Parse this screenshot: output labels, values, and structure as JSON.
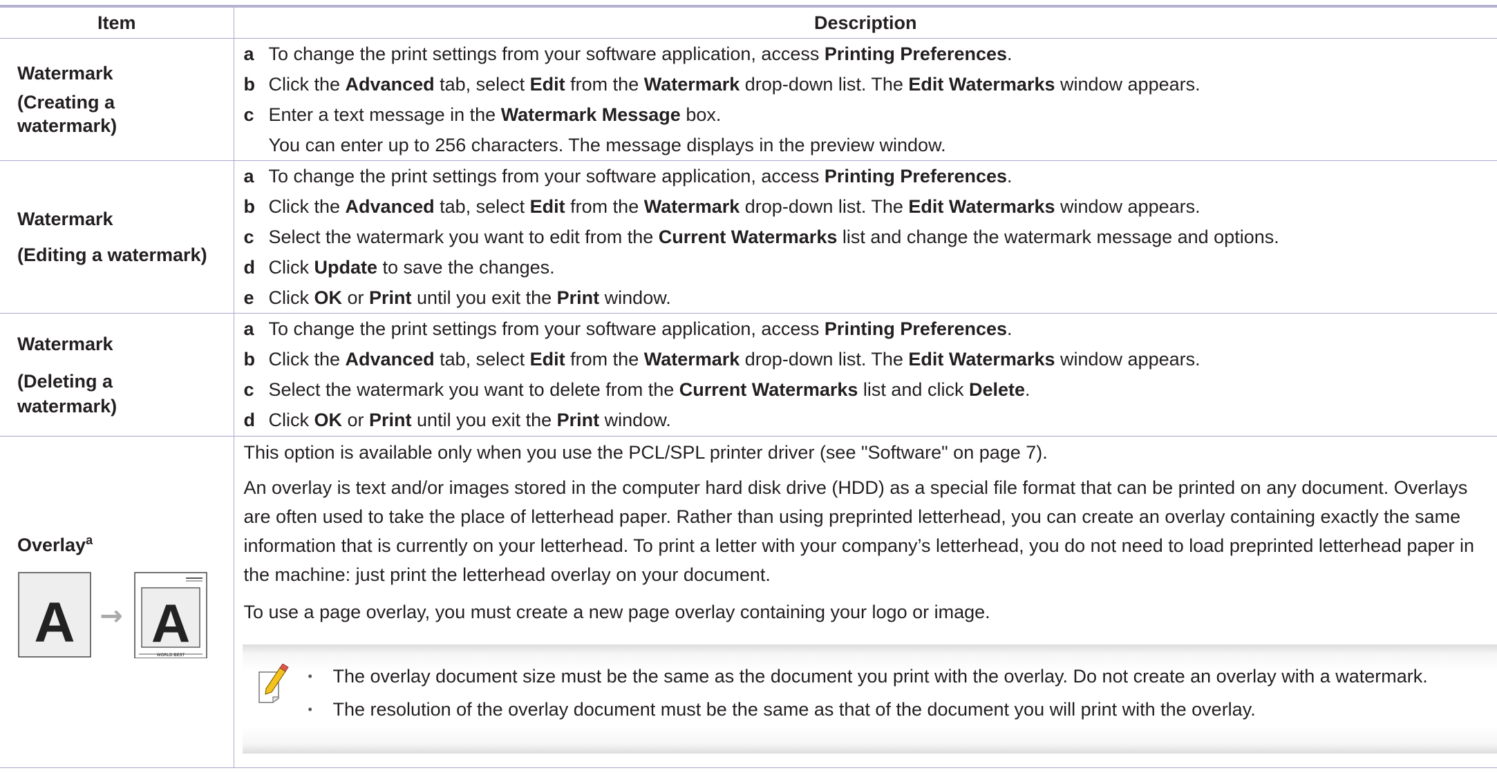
{
  "header": {
    "item": "Item",
    "description": "Description"
  },
  "rows": [
    {
      "item_lines": [
        "Watermark",
        "(Creating a",
        "watermark)"
      ],
      "steps": [
        {
          "letter": "a",
          "parts": [
            [
              "To change the print settings from your software application, access ",
              false
            ],
            [
              "Printing Preferences",
              true
            ],
            [
              ".",
              false
            ]
          ]
        },
        {
          "letter": "b",
          "parts": [
            [
              "Click the ",
              false
            ],
            [
              "Advanced",
              true
            ],
            [
              " tab, select ",
              false
            ],
            [
              "Edit",
              true
            ],
            [
              " from the ",
              false
            ],
            [
              "Watermark",
              true
            ],
            [
              " drop-down list. The ",
              false
            ],
            [
              "Edit Watermarks",
              true
            ],
            [
              " window appears.",
              false
            ]
          ]
        },
        {
          "letter": "c",
          "parts": [
            [
              "Enter a text message in the ",
              false
            ],
            [
              "Watermark Message",
              true
            ],
            [
              " box.",
              false
            ]
          ]
        },
        {
          "letter": "",
          "parts": [
            [
              "You can enter up to 256 characters. The message displays in the preview window.",
              false
            ]
          ]
        }
      ]
    },
    {
      "item_lines": [
        "Watermark",
        "(Editing a watermark)"
      ],
      "steps": [
        {
          "letter": "a",
          "parts": [
            [
              "To change the print settings from your software application, access ",
              false
            ],
            [
              "Printing Preferences",
              true
            ],
            [
              ".",
              false
            ]
          ]
        },
        {
          "letter": "b",
          "parts": [
            [
              "Click the ",
              false
            ],
            [
              "Advanced",
              true
            ],
            [
              " tab, select ",
              false
            ],
            [
              "Edit",
              true
            ],
            [
              " from the ",
              false
            ],
            [
              "Watermark",
              true
            ],
            [
              " drop-down list. The ",
              false
            ],
            [
              "Edit Watermarks",
              true
            ],
            [
              " window appears.",
              false
            ]
          ]
        },
        {
          "letter": "c",
          "parts": [
            [
              "Select the watermark you want to edit from the ",
              false
            ],
            [
              "Current Watermarks",
              true
            ],
            [
              " list and change the watermark message and options.",
              false
            ]
          ]
        },
        {
          "letter": "d",
          "parts": [
            [
              "Click ",
              false
            ],
            [
              "Update",
              true
            ],
            [
              " to save the changes.",
              false
            ]
          ]
        },
        {
          "letter": "e",
          "parts": [
            [
              "Click ",
              false
            ],
            [
              "OK",
              true
            ],
            [
              " or ",
              false
            ],
            [
              "Print",
              true
            ],
            [
              " until you exit the ",
              false
            ],
            [
              "Print",
              true
            ],
            [
              " window.",
              false
            ]
          ]
        }
      ]
    },
    {
      "item_lines": [
        "Watermark",
        "(Deleting a",
        "watermark)"
      ],
      "steps": [
        {
          "letter": "a",
          "parts": [
            [
              "To change the print settings from your software application, access ",
              false
            ],
            [
              "Printing Preferences",
              true
            ],
            [
              ".",
              false
            ]
          ]
        },
        {
          "letter": "b",
          "parts": [
            [
              "Click the ",
              false
            ],
            [
              "Advanced",
              true
            ],
            [
              " tab, select ",
              false
            ],
            [
              "Edit",
              true
            ],
            [
              " from the ",
              false
            ],
            [
              "Watermark",
              true
            ],
            [
              " drop-down list. The ",
              false
            ],
            [
              "Edit Watermarks",
              true
            ],
            [
              " window appears.",
              false
            ]
          ]
        },
        {
          "letter": "c",
          "parts": [
            [
              "Select the watermark you want to delete from the ",
              false
            ],
            [
              "Current Watermarks",
              true
            ],
            [
              " list and click ",
              false
            ],
            [
              "Delete",
              true
            ],
            [
              ".",
              false
            ]
          ]
        },
        {
          "letter": "d",
          "parts": [
            [
              "Click ",
              false
            ],
            [
              "OK",
              true
            ],
            [
              " or ",
              false
            ],
            [
              "Print",
              true
            ],
            [
              " until you exit the ",
              false
            ],
            [
              "Print",
              true
            ],
            [
              " window.",
              false
            ]
          ]
        }
      ]
    }
  ],
  "overlay": {
    "label": "Overlay",
    "sup": "a",
    "diagram": {
      "letter": "A",
      "arrow": "→",
      "footer_text": "WORLD BEST"
    },
    "p1": "This option is available only when you use the PCL/SPL printer driver (see \"Software\" on page 7).",
    "p2": "An overlay is text and/or images stored in the computer hard disk drive (HDD) as a special file format that can be printed on any document. Overlays are often used to take the place of letterhead paper. Rather than using preprinted letterhead, you can create an overlay containing exactly the same information that is currently on your letterhead. To print a letter with your company’s letterhead, you do not need to load preprinted letterhead paper in the machine: just print the letterhead overlay on your document.",
    "p3": "To use a page overlay, you must create a new page overlay containing your logo or image.",
    "note_icon": "note-pencil-icon",
    "bullet": "•",
    "notes": [
      "The overlay document size must be the same as the document you print with the overlay. Do not create an overlay with a watermark.",
      "The resolution of the overlay document must be the same as that of the document you will print with the overlay."
    ]
  }
}
